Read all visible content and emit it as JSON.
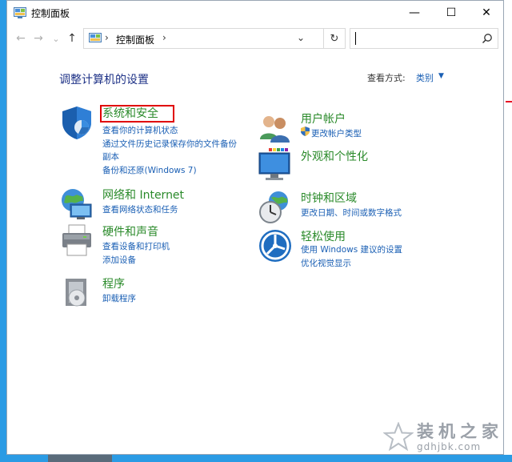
{
  "window": {
    "title": "控制面板",
    "minimize": "—",
    "maximize": "☐",
    "close": "✕"
  },
  "nav": {
    "back": "←",
    "forward": "→",
    "recent": "⌄",
    "up": "↑"
  },
  "address": {
    "sep": "›",
    "path": "控制面板",
    "sep2": "›",
    "dropdown": "⌄",
    "refresh": "↻"
  },
  "search": {
    "placeholder": ""
  },
  "header": {
    "title": "调整计算机的设置",
    "view_by_label": "查看方式:",
    "view_by_value": "类别"
  },
  "categories": {
    "security": {
      "title": "系统和安全",
      "links": [
        "查看你的计算机状态",
        "通过文件历史记录保存你的文件备份",
        "副本",
        "备份和还原(Windows 7)"
      ]
    },
    "network": {
      "title": "网络和 Internet",
      "links": [
        "查看网络状态和任务"
      ]
    },
    "hardware": {
      "title": "硬件和声音",
      "links": [
        "查看设备和打印机",
        "添加设备"
      ]
    },
    "programs": {
      "title": "程序",
      "links": [
        "卸载程序"
      ]
    },
    "accounts": {
      "title": "用户帐户",
      "links": [
        "更改帐户类型"
      ]
    },
    "appearance": {
      "title": "外观和个性化",
      "links": []
    },
    "clock": {
      "title": "时钟和区域",
      "links": [
        "更改日期、时间或数字格式"
      ]
    },
    "ease": {
      "title": "轻松使用",
      "links": [
        "使用 Windows 建议的设置",
        "优化视觉显示"
      ]
    }
  },
  "watermark": {
    "title": "装机之家",
    "url": "gdhjbk.com"
  },
  "colors": {
    "link": "#1a5fb4",
    "heading": "#2a8a2a",
    "title": "#1e3287",
    "highlight": "#e00000"
  }
}
